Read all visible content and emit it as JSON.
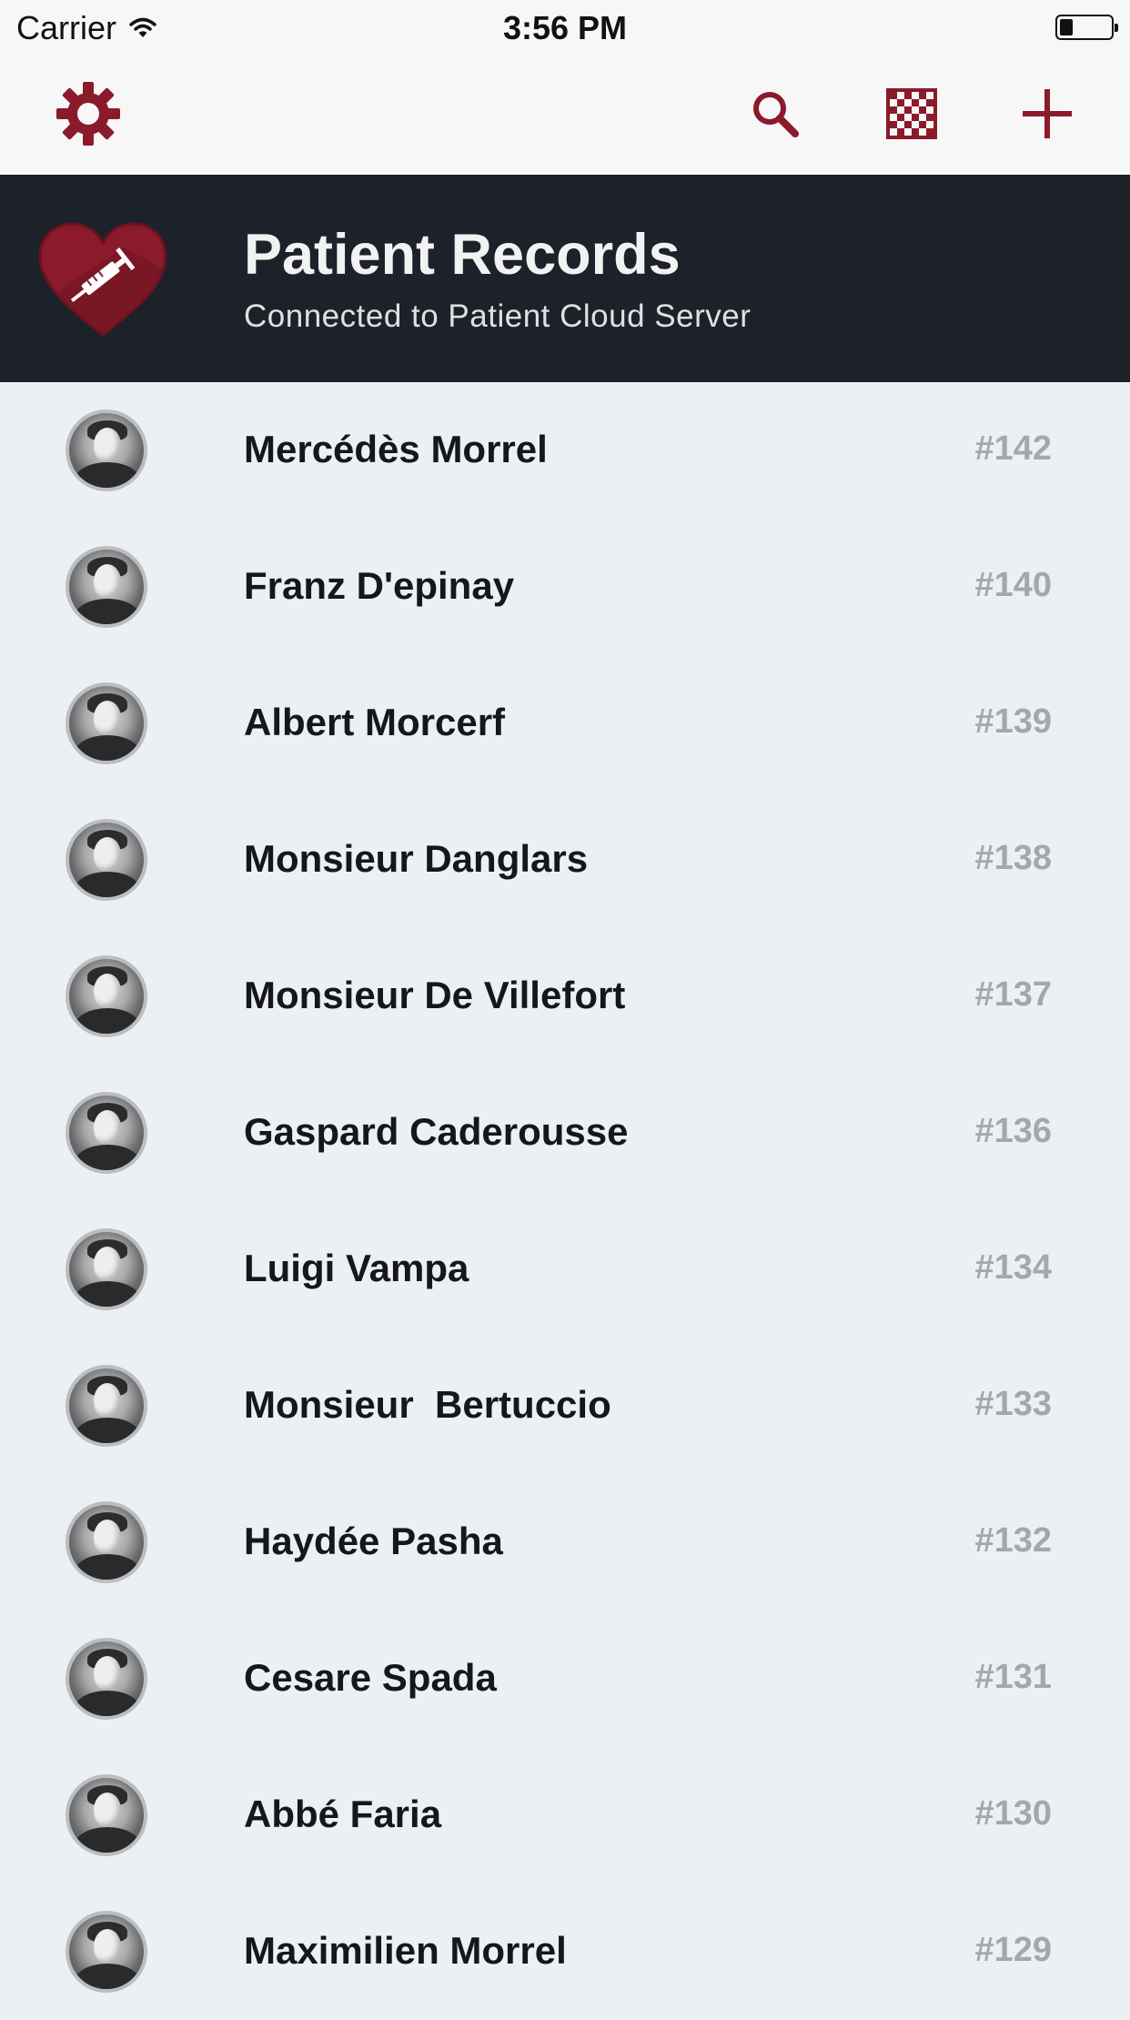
{
  "status_bar": {
    "carrier": "Carrier",
    "time": "3:56 PM",
    "battery_level": 0.25
  },
  "toolbar": {
    "settings_icon": "gear-icon",
    "search_icon": "search-icon",
    "grid_icon": "checkerboard-icon",
    "add_icon": "plus-icon",
    "accent_color": "#8b1a2b"
  },
  "header": {
    "title": "Patient Records",
    "subtitle": "Connected to Patient Cloud Server",
    "logo_icon": "heart-syringe-icon"
  },
  "patients": [
    {
      "name": "Mercédès Morrel",
      "id": "#142"
    },
    {
      "name": "Franz D'epinay",
      "id": "#140"
    },
    {
      "name": "Albert Morcerf",
      "id": "#139"
    },
    {
      "name": "Monsieur Danglars",
      "id": "#138"
    },
    {
      "name": "Monsieur De Villefort",
      "id": "#137"
    },
    {
      "name": "Gaspard Caderousse",
      "id": "#136"
    },
    {
      "name": "Luigi Vampa",
      "id": "#134"
    },
    {
      "name": "Monsieur  Bertuccio",
      "id": "#133"
    },
    {
      "name": "Haydée Pasha",
      "id": "#132"
    },
    {
      "name": "Cesare Spada",
      "id": "#131"
    },
    {
      "name": "Abbé Faria",
      "id": "#130"
    },
    {
      "name": "Maximilien Morrel",
      "id": "#129"
    }
  ]
}
